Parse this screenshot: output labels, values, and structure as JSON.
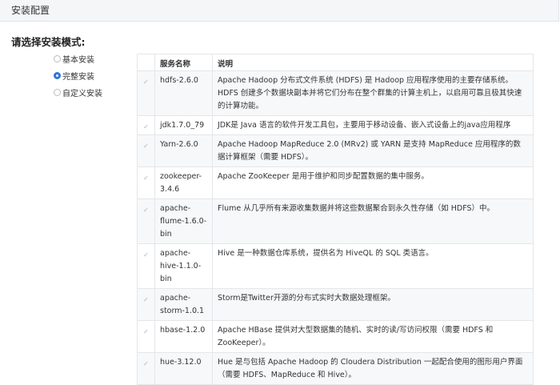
{
  "header": {
    "title": "安装配置"
  },
  "prompt": "请选择安装模式:",
  "modes": [
    {
      "label": "基本安装",
      "checked": false
    },
    {
      "label": "完整安装",
      "checked": true
    },
    {
      "label": "自定义安装",
      "checked": false
    }
  ],
  "table": {
    "headers": [
      "服务名称",
      "说明"
    ],
    "rows": [
      {
        "name": "hdfs-2.6.0",
        "desc": "Apache Hadoop 分布式文件系统 (HDFS) 是 Hadoop 应用程序使用的主要存储系统。HDFS 创建多个数据块副本并将它们分布在整个群集的计算主机上，以启用可靠且极其快速的计算功能。"
      },
      {
        "name": "jdk1.7.0_79",
        "desc": "JDK是 Java 语言的软件开发工具包，主要用于移动设备、嵌入式设备上的java应用程序"
      },
      {
        "name": "Yarn-2.6.0",
        "desc": "Apache Hadoop MapReduce 2.0 (MRv2) 或 YARN 是支持 MapReduce 应用程序的数据计算框架（需要 HDFS）。"
      },
      {
        "name": "zookeeper-3.4.6",
        "desc": "Apache ZooKeeper 是用于维护和同步配置数据的集中服务。"
      },
      {
        "name": "apache-flume-1.6.0-bin",
        "desc": "Flume 从几乎所有来源收集数据并将这些数据聚合到永久性存储（如 HDFS）中。"
      },
      {
        "name": "apache-hive-1.1.0-bin",
        "desc": "Hive 是一种数据仓库系统，提供名为 HiveQL 的 SQL 类语言。"
      },
      {
        "name": "apache-storm-1.0.1",
        "desc": "Storm是Twitter开源的分布式实时大数据处理框架。"
      },
      {
        "name": "hbase-1.2.0",
        "desc": "Apache HBase 提供对大型数据集的随机、实时的读/写访问权限（需要 HDFS 和 ZooKeeper）。"
      },
      {
        "name": "hue-3.12.0",
        "desc": "Hue 是与包括 Apache Hadoop 的 Cloudera Distribution 一起配合使用的图形用户界面（需要 HDFS、MapReduce 和 Hive）。"
      }
    ]
  }
}
